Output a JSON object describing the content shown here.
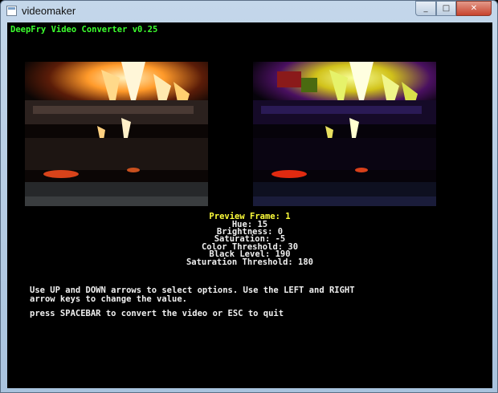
{
  "window": {
    "title": "videomaker",
    "minimize_glyph": "_",
    "maximize_glyph": "□",
    "close_glyph": "✕"
  },
  "app": {
    "header": "DeepFry Video Converter v0.25"
  },
  "preview": {
    "frame_label": "Preview Frame: 1",
    "settings": [
      "Hue: 15",
      "Brightness: 0",
      "Saturation: -5",
      "Color Threshold: 30",
      "Black Level: 190",
      "Saturation Threshold: 180"
    ]
  },
  "help": {
    "line1": "Use UP and DOWN arrows to select options. Use the LEFT and RIGHT",
    "line2": "arrow keys to change the value.",
    "line3": "press SPACEBAR to convert the video or ESC to quit"
  },
  "colors": {
    "header": "#3cff2e",
    "selected": "#ffff3a",
    "text": "#f0f0f0"
  }
}
